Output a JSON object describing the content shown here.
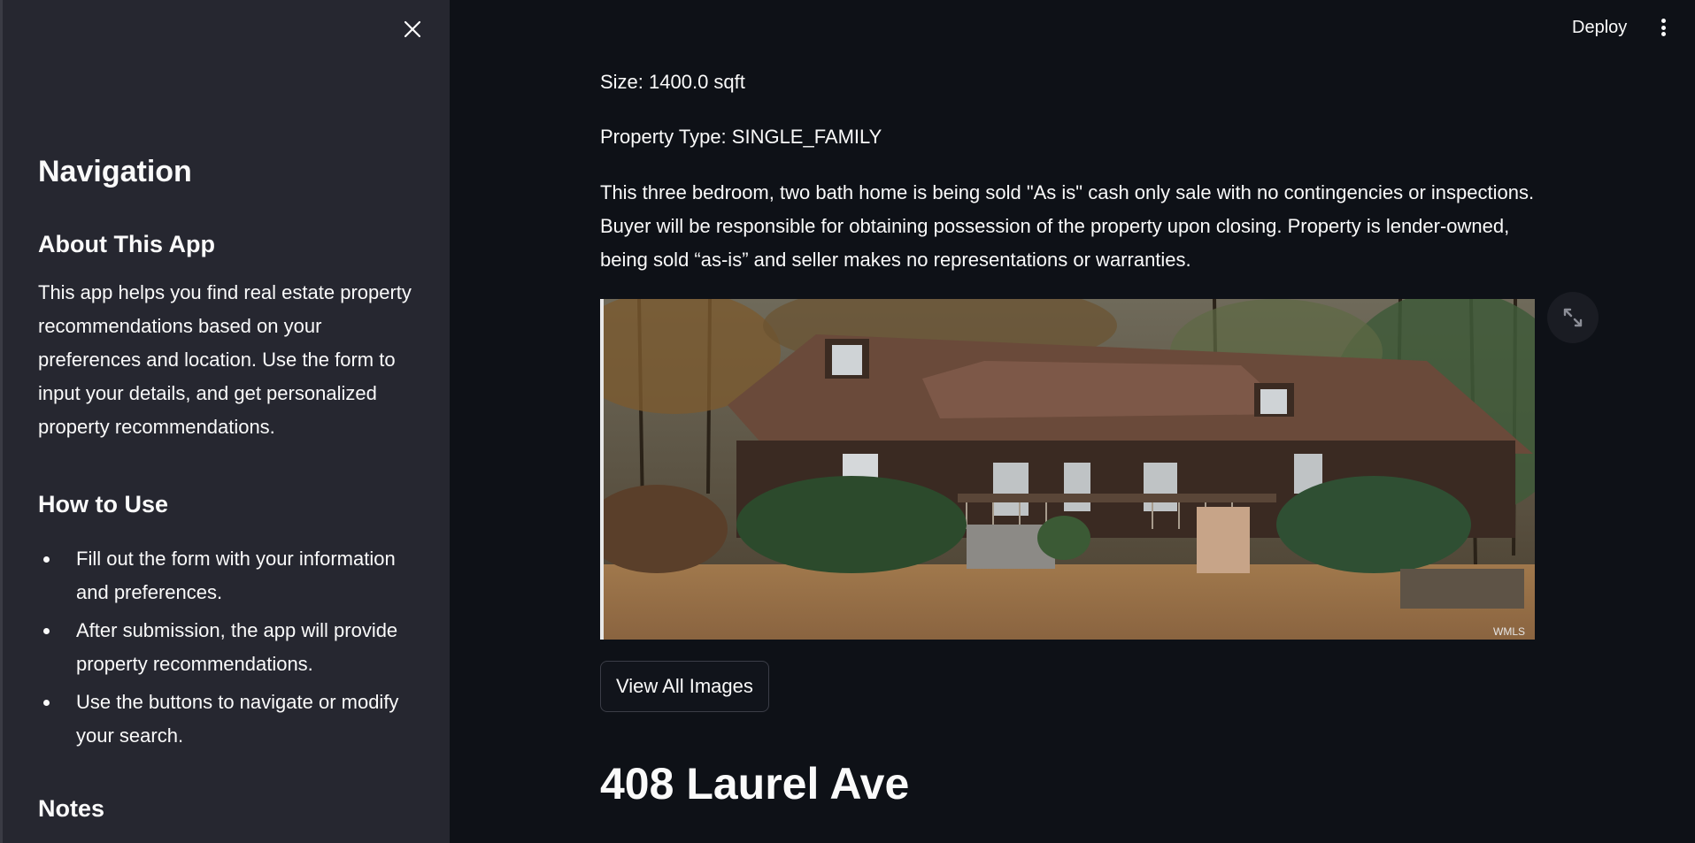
{
  "sidebar": {
    "title": "Navigation",
    "about_heading": "About This App",
    "about_text": "This app helps you find real estate property recommendations based on your preferences and location. Use the form to input your details, and get personalized property recommendations.",
    "howto_heading": "How to Use",
    "howto_items": [
      "Fill out the form with your information and preferences.",
      "After submission, the app will provide property recommendations.",
      "Use the buttons to navigate or modify your search."
    ],
    "notes_heading": "Notes"
  },
  "toolbar": {
    "deploy_label": "Deploy"
  },
  "main": {
    "size_text": "Size: 1400.0 sqft",
    "property_type_text": "Property Type: SINGLE_FAMILY",
    "description": "This three bedroom, two bath home is being sold \"As is\" cash only sale with no contingencies or inspections. Buyer will be responsible for obtaining possession of the property upon closing. Property is lender-owned, being sold “as-is” and seller makes no representations or warranties.",
    "photo_watermark": "WMLS",
    "view_all_label": "View All Images",
    "next_address": "408 Laurel Ave"
  }
}
